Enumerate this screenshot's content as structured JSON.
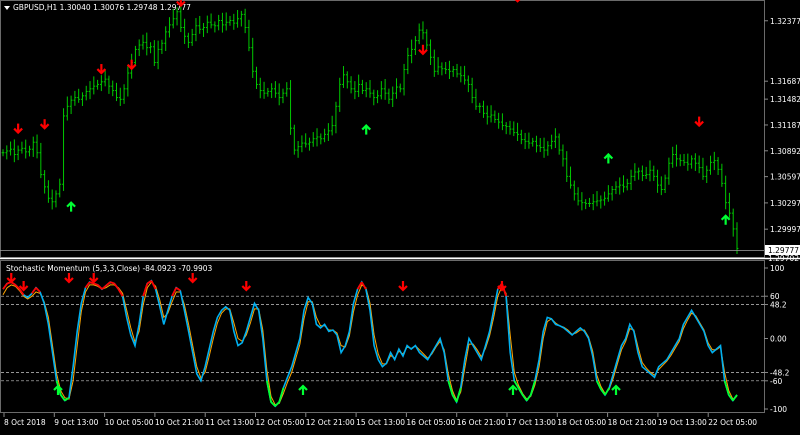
{
  "main_chart": {
    "symbol_header": "GBPUSD,H1  1.30040 1.30076 1.29748 1.29777",
    "current_price_label": "1.29777",
    "below_label": "1.29702",
    "colors": {
      "background": "#000000",
      "bar": "#00c800",
      "sell_arrow": "#ff0000",
      "buy_arrow": "#00ff33"
    },
    "price_ticks": [
      "1.32377",
      "1.31687",
      "1.31482",
      "1.31187",
      "1.30892",
      "1.30597",
      "1.30297",
      "1.29997"
    ]
  },
  "indicator": {
    "title": "Stochastic Momentum (5,3,3,Close) -84.0923 -70.9903",
    "levels": [
      "100",
      "60",
      "48.2",
      "0.00",
      "-48.2",
      "-60",
      "-100"
    ],
    "colors": {
      "main_line": "#00b0f0",
      "signal_line": "#ffa500",
      "overbought": "#ff0000",
      "oversold": "#00ff33",
      "level_line": "#c8c8c8"
    }
  },
  "time_axis": {
    "labels": [
      "8 Oct 2018",
      "9 Oct 13:00",
      "10 Oct 05:00",
      "10 Oct 21:00",
      "11 Oct 13:00",
      "12 Oct 05:00",
      "12 Oct 21:00",
      "15 Oct 13:00",
      "16 Oct 05:00",
      "16 Oct 21:00",
      "17 Oct 13:00",
      "18 Oct 05:00",
      "18 Oct 21:00",
      "19 Oct 13:00",
      "22 Oct 05:00"
    ]
  },
  "chart_data": {
    "type": "line",
    "price_series": {
      "name": "GBPUSD",
      "x_range": [
        0,
        195
      ],
      "close": [
        1.3087,
        1.3089,
        1.3091,
        1.3085,
        1.309,
        1.3092,
        1.3088,
        1.3091,
        1.3099,
        1.3087,
        1.3062,
        1.3048,
        1.3035,
        1.3031,
        1.304,
        1.3051,
        1.3129,
        1.314,
        1.3147,
        1.315,
        1.3148,
        1.3152,
        1.3157,
        1.316,
        1.3163,
        1.3165,
        1.3168,
        1.3171,
        1.3163,
        1.3158,
        1.315,
        1.3148,
        1.316,
        1.3178,
        1.319,
        1.3205,
        1.321,
        1.3213,
        1.3207,
        1.3208,
        1.319,
        1.3205,
        1.3212,
        1.3225,
        1.3233,
        1.324,
        1.3248,
        1.323,
        1.322,
        1.3213,
        1.3222,
        1.3232,
        1.3228,
        1.323,
        1.3236,
        1.3233,
        1.3232,
        1.3238,
        1.3233,
        1.3236,
        1.3238,
        1.3235,
        1.324,
        1.3245,
        1.323,
        1.3207,
        1.318,
        1.3165,
        1.3158,
        1.3155,
        1.3157,
        1.316,
        1.3155,
        1.315,
        1.3155,
        1.316,
        1.3115,
        1.309,
        1.3094,
        1.3098,
        1.3097,
        1.3099,
        1.3103,
        1.3105,
        1.3103,
        1.3108,
        1.3112,
        1.3118,
        1.314,
        1.3165,
        1.3176,
        1.3168,
        1.316,
        1.3157,
        1.3165,
        1.3158,
        1.316,
        1.3155,
        1.315,
        1.3152,
        1.316,
        1.3155,
        1.3148,
        1.3155,
        1.3162,
        1.316,
        1.3182,
        1.3198,
        1.3205,
        1.3215,
        1.3227,
        1.3224,
        1.321,
        1.3196,
        1.318,
        1.3185,
        1.3183,
        1.3182,
        1.318,
        1.3182,
        1.3177,
        1.3175,
        1.317,
        1.3165,
        1.315,
        1.314,
        1.314,
        1.3132,
        1.3128,
        1.313,
        1.3125,
        1.3122,
        1.3118,
        1.3117,
        1.3114,
        1.311,
        1.3108,
        1.3102,
        1.31,
        1.3098,
        1.31,
        1.3095,
        1.3093,
        1.309,
        1.3095,
        1.31,
        1.3105,
        1.309,
        1.308,
        1.306,
        1.305,
        1.304,
        1.3032,
        1.303,
        1.3029,
        1.3029,
        1.3031,
        1.3032,
        1.3033,
        1.3035,
        1.304,
        1.3045,
        1.3048,
        1.305,
        1.3048,
        1.3052,
        1.306,
        1.3065,
        1.3066,
        1.3061,
        1.3062,
        1.3067,
        1.306,
        1.305,
        1.3045,
        1.3058,
        1.3075,
        1.3085,
        1.308,
        1.3078,
        1.3076,
        1.3074,
        1.308,
        1.3075,
        1.307,
        1.306,
        1.3067,
        1.3076,
        1.3078,
        1.3068,
        1.3052,
        1.303,
        1.3018,
        1.3,
        1.29777
      ],
      "ylim": [
        1.29702,
        1.325
      ]
    },
    "sell_signals": [
      {
        "index": 4,
        "price": 1.311
      },
      {
        "index": 11,
        "price": 1.3115
      },
      {
        "index": 26,
        "price": 1.3178
      },
      {
        "index": 34,
        "price": 1.3183
      },
      {
        "index": 47,
        "price": 1.3255
      },
      {
        "index": 111,
        "price": 1.32
      },
      {
        "index": 136,
        "price": 1.326
      },
      {
        "index": 184,
        "price": 1.3118
      }
    ],
    "buy_signals": [
      {
        "index": 18,
        "price": 1.303
      },
      {
        "index": 96,
        "price": 1.3118
      },
      {
        "index": 160,
        "price": 1.3085
      },
      {
        "index": 191,
        "price": 1.3015
      }
    ],
    "stochastic_momentum": {
      "ylim": [
        -100,
        100
      ],
      "main": [
        70,
        78,
        80,
        76,
        70,
        62,
        58,
        64,
        72,
        66,
        50,
        20,
        -20,
        -60,
        -80,
        -88,
        -84,
        -40,
        10,
        50,
        72,
        80,
        78,
        76,
        70,
        75,
        80,
        78,
        70,
        60,
        30,
        5,
        -10,
        20,
        60,
        78,
        82,
        70,
        46,
        20,
        40,
        60,
        72,
        68,
        40,
        10,
        -20,
        -50,
        -60,
        -40,
        -15,
        10,
        30,
        40,
        45,
        40,
        10,
        -10,
        -6,
        10,
        30,
        50,
        40,
        0,
        -60,
        -90,
        -96,
        -90,
        -70,
        -55,
        -40,
        -20,
        0,
        40,
        58,
        50,
        20,
        15,
        20,
        10,
        12,
        5,
        -20,
        -10,
        10,
        50,
        70,
        80,
        70,
        40,
        -10,
        -30,
        -40,
        -35,
        -20,
        -30,
        -15,
        -25,
        -10,
        -15,
        -10,
        -20,
        -25,
        -30,
        -20,
        -10,
        0,
        -20,
        -60,
        -80,
        -90,
        -70,
        -30,
        0,
        -10,
        -20,
        -30,
        -10,
        10,
        40,
        70,
        78,
        60,
        -20,
        -60,
        -70,
        -80,
        -88,
        -80,
        -60,
        -30,
        10,
        30,
        28,
        20,
        18,
        15,
        10,
        5,
        10,
        15,
        10,
        0,
        -25,
        -60,
        -72,
        -80,
        -70,
        -50,
        -30,
        -10,
        0,
        20,
        10,
        -20,
        -40,
        -45,
        -50,
        -55,
        -40,
        -35,
        -30,
        -20,
        -10,
        0,
        20,
        30,
        40,
        30,
        20,
        10,
        -10,
        -20,
        -15,
        -10,
        -60,
        -80,
        -88,
        -80
      ],
      "signal": [
        62,
        72,
        76,
        74,
        68,
        60,
        56,
        60,
        66,
        64,
        52,
        30,
        -10,
        -50,
        -74,
        -84,
        -86,
        -60,
        -10,
        38,
        66,
        76,
        76,
        74,
        70,
        72,
        76,
        76,
        72,
        64,
        40,
        15,
        -5,
        10,
        48,
        72,
        80,
        74,
        55,
        30,
        36,
        52,
        66,
        66,
        48,
        20,
        -10,
        -40,
        -56,
        -48,
        -25,
        0,
        22,
        36,
        42,
        42,
        22,
        0,
        -4,
        5,
        22,
        42,
        42,
        12,
        -45,
        -82,
        -94,
        -92,
        -78,
        -62,
        -48,
        -28,
        -8,
        28,
        52,
        52,
        30,
        18,
        18,
        12,
        12,
        8,
        -10,
        -12,
        4,
        38,
        62,
        76,
        72,
        50,
        5,
        -22,
        -36,
        -36,
        -24,
        -28,
        -18,
        -22,
        -12,
        -14,
        -10,
        -16,
        -22,
        -28,
        -22,
        -12,
        -4,
        -16,
        -50,
        -74,
        -88,
        -76,
        -42,
        -8,
        -8,
        -16,
        -26,
        -14,
        4,
        30,
        60,
        74,
        64,
        5,
        -48,
        -66,
        -78,
        -86,
        -82,
        -66,
        -40,
        0,
        24,
        28,
        22,
        18,
        16,
        12,
        6,
        8,
        12,
        12,
        2,
        -18,
        -52,
        -68,
        -78,
        -72,
        -56,
        -36,
        -16,
        -4,
        14,
        12,
        -12,
        -34,
        -42,
        -48,
        -52,
        -44,
        -38,
        -32,
        -24,
        -14,
        -4,
        14,
        26,
        36,
        32,
        22,
        12,
        -6,
        -16,
        -16,
        -12,
        -48,
        -74,
        -86,
        -82
      ]
    }
  }
}
